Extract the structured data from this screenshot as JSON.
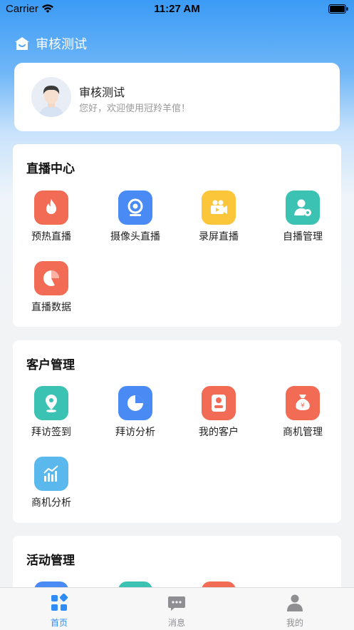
{
  "status_bar": {
    "carrier": "Carrier",
    "time": "11:27 AM"
  },
  "header": {
    "title": "审核测试"
  },
  "profile": {
    "name": "审核测试",
    "greeting": "您好，欢迎使用冠羚羊倌！"
  },
  "sections": [
    {
      "title": "直播中心",
      "items": [
        {
          "label": "预热直播",
          "icon": "flame-icon",
          "color": "#f26b55"
        },
        {
          "label": "摄像头直播",
          "icon": "camera-icon",
          "color": "#4a8af4"
        },
        {
          "label": "录屏直播",
          "icon": "video-recorder-icon",
          "color": "#fcc63a"
        },
        {
          "label": "自播管理",
          "icon": "user-settings-icon",
          "color": "#3cc2b3"
        },
        {
          "label": "直播数据",
          "icon": "pie-chart-icon",
          "color": "#f26b55"
        }
      ]
    },
    {
      "title": "客户管理",
      "items": [
        {
          "label": "拜访签到",
          "icon": "location-pin-icon",
          "color": "#3cc2b3"
        },
        {
          "label": "拜访分析",
          "icon": "pie-chart-icon",
          "color": "#4a8af4"
        },
        {
          "label": "我的客户",
          "icon": "user-icon",
          "color": "#f26b55"
        },
        {
          "label": "商机管理",
          "icon": "money-bag-icon",
          "color": "#f26b55"
        },
        {
          "label": "商机分析",
          "icon": "bar-chart-icon",
          "color": "#5bb8ec"
        }
      ]
    },
    {
      "title": "活动管理",
      "items": [
        {
          "label": "",
          "icon": "tile-icon",
          "color": "#4a8af4"
        },
        {
          "label": "",
          "icon": "tile-icon",
          "color": "#3cc2b3"
        },
        {
          "label": "",
          "icon": "tile-icon",
          "color": "#f26b55"
        }
      ]
    }
  ],
  "tab_bar": {
    "active_color": "#2f8cf5",
    "inactive_color": "#8e8e93",
    "tabs": [
      {
        "label": "首页",
        "icon": "grid-home-icon",
        "active": true
      },
      {
        "label": "消息",
        "icon": "chat-bubble-icon",
        "active": false
      },
      {
        "label": "我的",
        "icon": "person-icon",
        "active": false
      }
    ]
  }
}
